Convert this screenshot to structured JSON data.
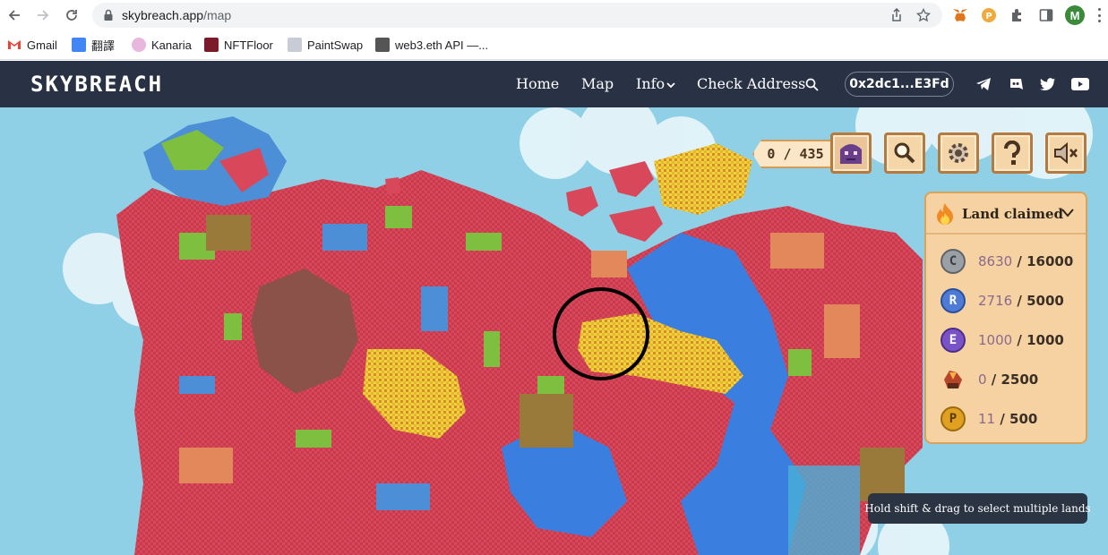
{
  "browser": {
    "url_host": "skybreach.app",
    "url_path": "/map",
    "avatar_letter": "M"
  },
  "bookmarks": [
    {
      "label": "Gmail",
      "color": "#ea4335"
    },
    {
      "label": "翻譯",
      "color": "#4285f4"
    },
    {
      "label": "Kanaria",
      "color": "#c678b8"
    },
    {
      "label": "NFTFloor",
      "color": "#7a1a2a"
    },
    {
      "label": "PaintSwap",
      "color": "#9a9aa8"
    },
    {
      "label": "web3.eth API —...",
      "color": "#555555"
    }
  ],
  "header": {
    "logo": "SKYBREACH",
    "nav": {
      "home": "Home",
      "map": "Map",
      "info": "Info",
      "check_address": "Check Address"
    },
    "wallet": "0x2dc1...E3Fd"
  },
  "hud": {
    "counter": "0 / 435",
    "land_claimed_title": "Land claimed",
    "resources": [
      {
        "icon": "C",
        "current": "8630",
        "max": "16000",
        "color": "#9aa0a6"
      },
      {
        "icon": "R",
        "current": "2716",
        "max": "5000",
        "color": "#4d7bd6"
      },
      {
        "icon": "E",
        "current": "1000",
        "max": "1000",
        "color": "#7a52c8"
      },
      {
        "icon": "",
        "current": "0",
        "max": "2500",
        "color": "#b8452a"
      },
      {
        "icon": "P",
        "current": "11",
        "max": "500",
        "color": "#e0a020"
      }
    ],
    "tooltip": "Hold shift & drag to select multiple lands"
  }
}
